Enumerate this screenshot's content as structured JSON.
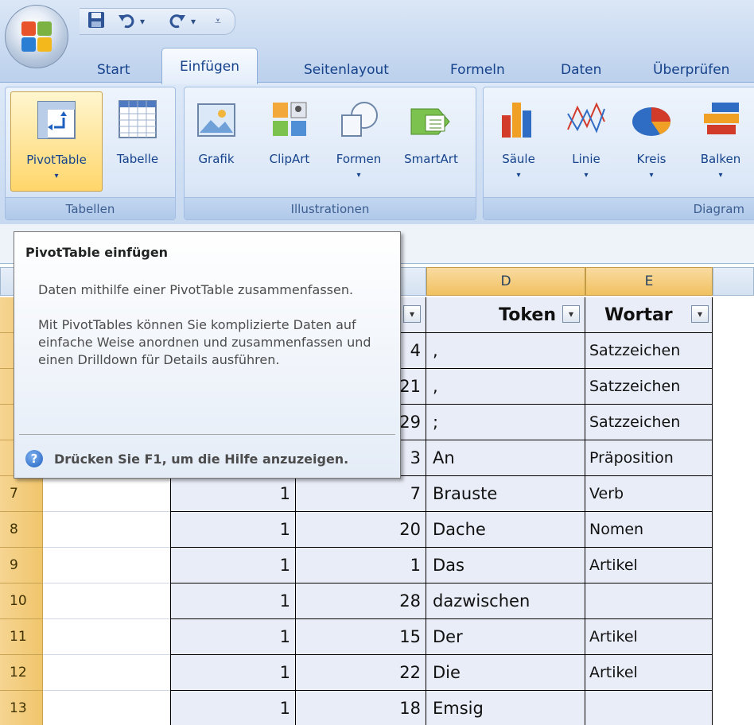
{
  "quick_access": {
    "save_icon": "save-icon",
    "undo_icon": "undo-icon",
    "redo_icon": "redo-icon",
    "customize_icon": "customize-qat-icon"
  },
  "tabs": [
    {
      "label": "Start"
    },
    {
      "label": "Einfügen",
      "active": true
    },
    {
      "label": "Seitenlayout"
    },
    {
      "label": "Formeln"
    },
    {
      "label": "Daten"
    },
    {
      "label": "Überprüfen"
    }
  ],
  "ribbon": {
    "tabellen": {
      "label": "Tabellen",
      "buttons": [
        {
          "label": "PivotTable",
          "icon": "pivottable-icon"
        },
        {
          "label": "Tabelle",
          "icon": "table-icon"
        }
      ]
    },
    "illustrationen": {
      "label": "Illustrationen",
      "buttons": [
        {
          "label": "Grafik",
          "icon": "picture-icon"
        },
        {
          "label": "ClipArt",
          "icon": "clipart-icon"
        },
        {
          "label": "Formen",
          "icon": "shapes-icon"
        },
        {
          "label": "SmartArt",
          "icon": "smartart-icon"
        }
      ]
    },
    "diagramme": {
      "label": "Diagram",
      "buttons": [
        {
          "label": "Säule",
          "icon": "column-chart-icon"
        },
        {
          "label": "Linie",
          "icon": "line-chart-icon"
        },
        {
          "label": "Kreis",
          "icon": "pie-chart-icon"
        },
        {
          "label": "Balken",
          "icon": "bar-chart-icon"
        }
      ]
    },
    "dropdown_arrow": "▾"
  },
  "tooltip": {
    "title": "PivotTable einfügen",
    "para1": "Daten mithilfe einer PivotTable zusammenfassen.",
    "para2": "Mit PivotTables können Sie komplizierte Daten auf einfache Weise anordnen und zusammenfassen und einen Drilldown für Details ausführen.",
    "help": "Drücken Sie F1, um die Hilfe anzuzeigen.",
    "help_icon": "?"
  },
  "sheet": {
    "columns": [
      "D",
      "E"
    ],
    "headers": {
      "token": "Token",
      "wortart": "Wortar"
    },
    "filter_arrow": "▾",
    "rows": [
      {
        "row": "",
        "c": "",
        "b": "4",
        "token": ",",
        "wortart": "Satzzeichen"
      },
      {
        "row": "",
        "c": "",
        "b": "21",
        "token": ",",
        "wortart": "Satzzeichen"
      },
      {
        "row": "",
        "c": "",
        "b": "29",
        "token": ";",
        "wortart": "Satzzeichen"
      },
      {
        "row": "",
        "c": "",
        "b": "3",
        "token": "An",
        "wortart": "Präposition"
      },
      {
        "row": "7",
        "c": "1",
        "b": "7",
        "token": "Brauste",
        "wortart": "Verb"
      },
      {
        "row": "8",
        "c": "1",
        "b": "20",
        "token": "Dache",
        "wortart": "Nomen"
      },
      {
        "row": "9",
        "c": "1",
        "b": "1",
        "token": "Das",
        "wortart": "Artikel"
      },
      {
        "row": "10",
        "c": "1",
        "b": "28",
        "token": "dazwischen",
        "wortart": ""
      },
      {
        "row": "11",
        "c": "1",
        "b": "15",
        "token": "Der",
        "wortart": "Artikel"
      },
      {
        "row": "12",
        "c": "1",
        "b": "22",
        "token": "Die",
        "wortart": "Artikel"
      },
      {
        "row": "13",
        "c": "1",
        "b": "18",
        "token": "Emsig",
        "wortart": ""
      }
    ]
  }
}
